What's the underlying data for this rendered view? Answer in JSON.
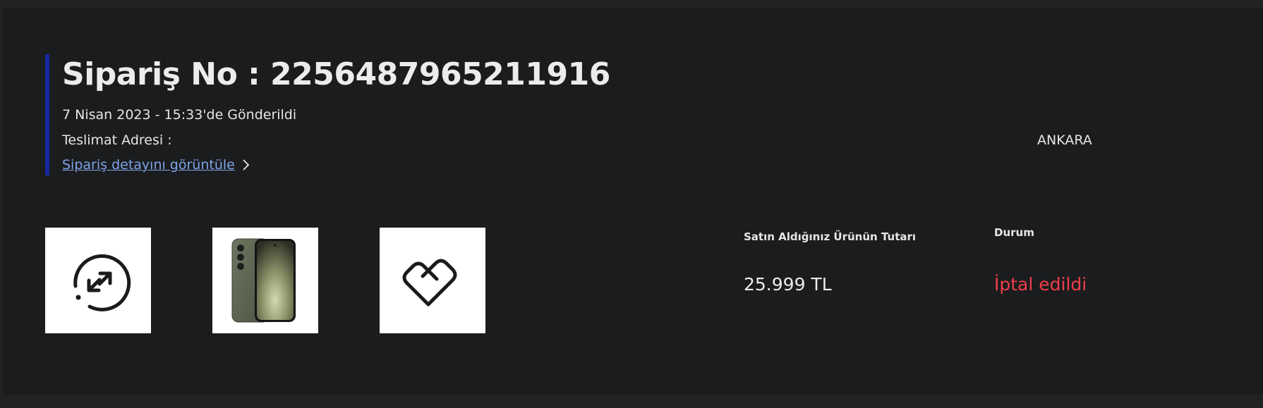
{
  "order": {
    "title": "Sipariş No : 2256487965211916",
    "sent_date": "7 Nisan 2023 - 15:33'de Gönderildi",
    "address_label": "Teslimat Adresi :",
    "address_value": "ANKARA",
    "detail_link": "Sipariş detayını görüntüle"
  },
  "products": [
    {
      "icon": "exchange-circle-icon"
    },
    {
      "icon": "phone-product-image"
    },
    {
      "icon": "heart-care-icon"
    }
  ],
  "summary": {
    "price_label": "Satın Aldığınız Ürünün Tutarı",
    "price_value": "25.999 TL",
    "status_label": "Durum",
    "status_value": "İptal edildi"
  },
  "colors": {
    "accent": "#1428a0",
    "link": "#7ea4e8",
    "status_cancelled": "#ef3e4a",
    "background": "#1b1c1e"
  }
}
